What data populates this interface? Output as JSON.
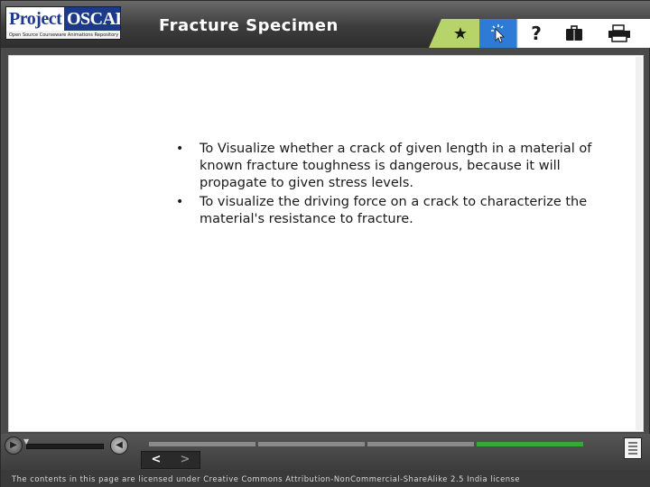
{
  "logo": {
    "name_part1": "Project",
    "name_part2": "OSCAR",
    "tagline": "Open Source Courseware Animations Repository"
  },
  "header": {
    "title": "Fracture Specimen"
  },
  "toolbar": {
    "tabs": [
      {
        "icon": "star-icon",
        "glyph": "★"
      },
      {
        "icon": "cursor-click-icon",
        "glyph": "⇱"
      },
      {
        "icon": "help-icon",
        "glyph": "?"
      },
      {
        "icon": "briefcase-icon",
        "glyph": "▮"
      },
      {
        "icon": "printer-icon",
        "glyph": "⎙"
      }
    ],
    "active_color": "#2e7bd6",
    "tab_color": "#b6d46a"
  },
  "content": {
    "bullets": [
      "To Visualize whether a crack of given length in a material of known fracture toughness is dangerous, because it will propagate to given stress levels.",
      "To visualize the driving force on a crack to characterize the material's resistance to fracture."
    ]
  },
  "player": {
    "prev_label": "<",
    "next_label": ">",
    "progress_segments": 4,
    "active_segment": 4,
    "progress_color": "#35a83a"
  },
  "footer": {
    "license": "The contents in this page are licensed under Creative Commons Attribution-NonCommercial-ShareAlike 2.5 India license"
  }
}
